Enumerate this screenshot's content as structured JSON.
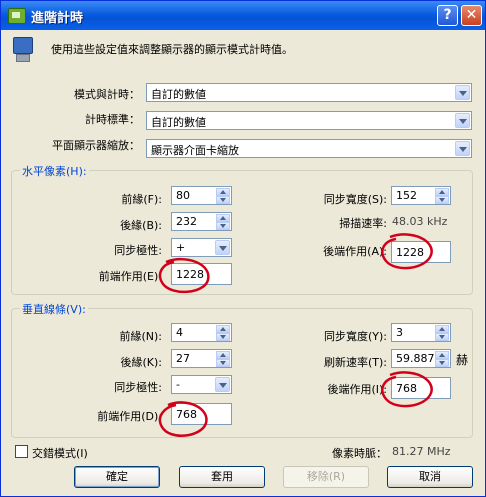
{
  "window": {
    "title": "進階計時",
    "help_glyph": "?",
    "close_glyph": "✕"
  },
  "description": "使用這些設定值來調整顯示器的顯示模式計時值。",
  "top": {
    "mode_label": "模式與計時：",
    "mode_value": "自訂的數値",
    "standard_label": "計時標準：",
    "standard_value": "自訂的數値",
    "scaling_label": "平面顯示器縮放：",
    "scaling_value": "顯示器介面卡縮放"
  },
  "horizontal": {
    "title": "水平像素(H):",
    "front_porch_label": "前緣(F):",
    "front_porch_value": "80",
    "back_porch_label": "後緣(B):",
    "back_porch_value": "232",
    "polarity_label": "同步極性:",
    "polarity_value": "+",
    "front_active_label": "前端作用(E):",
    "front_active_value": "1228",
    "sync_width_label": "同步寬度(S):",
    "sync_width_value": "152",
    "scan_rate_label": "掃描速率:",
    "scan_rate_value": "48.03",
    "scan_rate_unit": "kHz",
    "back_active_label": "後端作用(A):",
    "back_active_value": "1228"
  },
  "vertical": {
    "title": "垂直線條(V):",
    "front_porch_label": "前緣(N):",
    "front_porch_value": "4",
    "back_porch_label": "後緣(K):",
    "back_porch_value": "27",
    "polarity_label": "同步極性:",
    "polarity_value": "-",
    "front_active_label": "前端作用(D):",
    "front_active_value": "768",
    "sync_width_label": "同步寬度(Y):",
    "sync_width_value": "3",
    "refresh_label": "刷新速率(T):",
    "refresh_value": "59.887",
    "refresh_unit": "赫",
    "back_active_label": "後端作用(I):",
    "back_active_value": "768"
  },
  "interlace_label": "交錯模式(I)",
  "pixel_clock_label": "像素時脈：",
  "pixel_clock_value": "81.27",
  "pixel_clock_unit": "MHz",
  "buttons": {
    "ok": "確定",
    "apply": "套用",
    "remove": "移除(R)",
    "cancel": "取消"
  },
  "colors": {
    "annotation_ring": "#D0021B",
    "group_title": "#0046D5",
    "titlebar": "#0553D6"
  }
}
